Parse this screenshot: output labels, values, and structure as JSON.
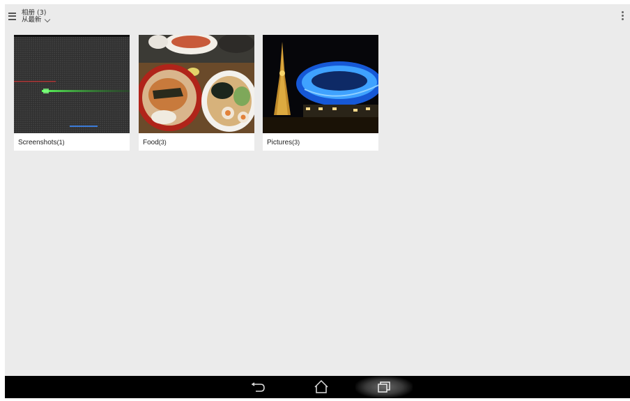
{
  "header": {
    "title": "相册",
    "title_count": "(3)",
    "sort_label": "从最新"
  },
  "albums": [
    {
      "name": "Screenshots",
      "count": "(1)"
    },
    {
      "name": "Food",
      "count": "(3)"
    },
    {
      "name": "Pictures",
      "count": "(3)"
    }
  ],
  "icons": {
    "menu": "hamburger-menu-icon",
    "overflow": "more-vertical-icon",
    "back": "back-icon",
    "home": "home-icon",
    "recents": "recent-apps-icon"
  },
  "colors": {
    "background": "#ebebeb",
    "navbar": "#000000"
  }
}
